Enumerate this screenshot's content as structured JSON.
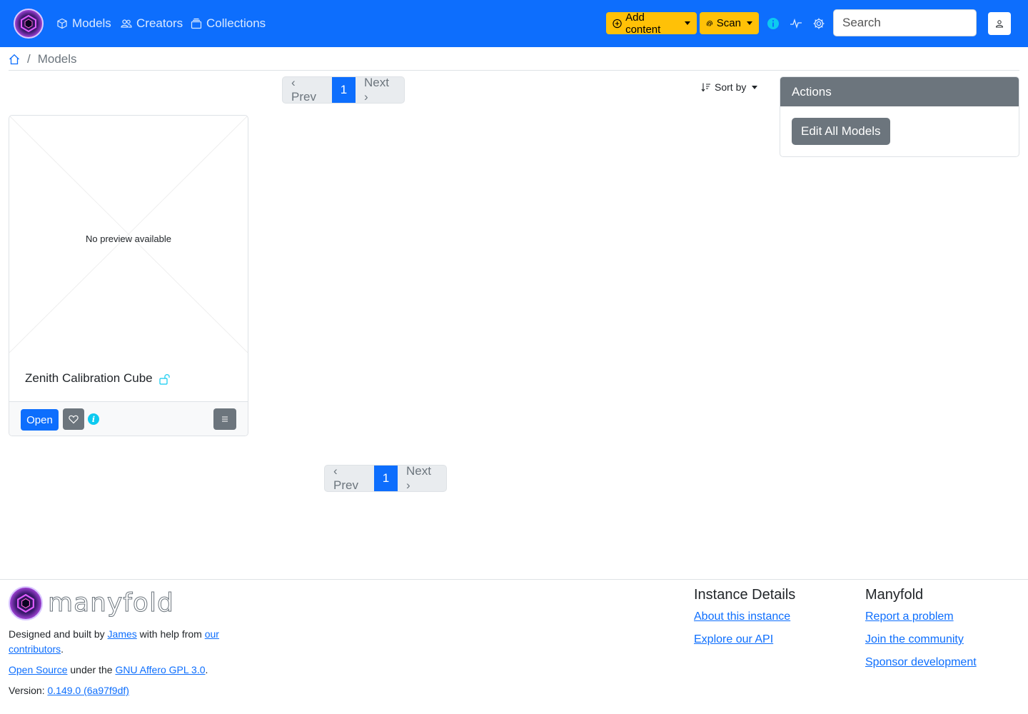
{
  "nav": {
    "links": [
      {
        "label": "Models",
        "icon": "box-icon"
      },
      {
        "label": "Creators",
        "icon": "people-icon"
      },
      {
        "label": "Collections",
        "icon": "collection-icon"
      }
    ],
    "add_content_label": "Add content",
    "scan_label": "Scan",
    "search_placeholder": "Search"
  },
  "breadcrumb": {
    "home_icon": "house-icon",
    "separator": "/",
    "current": "Models"
  },
  "pagination": {
    "prev_label": "‹ Prev",
    "current_page": "1",
    "next_label": "Next ›"
  },
  "sort": {
    "label": "Sort by"
  },
  "card": {
    "preview_text": "No preview available",
    "title": "Zenith Calibration Cube",
    "open_label": "Open",
    "info_label": "i"
  },
  "actions": {
    "header": "Actions",
    "edit_all_label": "Edit All Models"
  },
  "footer": {
    "wordmark": "manyfold",
    "built_prefix": "Designed and built by ",
    "author_link": "James",
    "built_middle": " with help from ",
    "contributors_link": "our contributors",
    "built_suffix": ".",
    "open_source_link": "Open Source",
    "license_middle": " under the ",
    "license_link": "GNU Affero GPL 3.0",
    "license_suffix": ".",
    "version_prefix": "Version: ",
    "version_link": "0.149.0 (6a97f9df)",
    "instance_title": "Instance Details",
    "instance_links": [
      "About this instance",
      "Explore our API"
    ],
    "manyfold_title": "Manyfold",
    "manyfold_links": [
      "Report a problem",
      "Join the community",
      "Sponsor development"
    ]
  },
  "colors": {
    "primary": "#0d6efd",
    "warning": "#ffc107",
    "secondary": "#6c757d",
    "info": "#0dcaf0"
  }
}
